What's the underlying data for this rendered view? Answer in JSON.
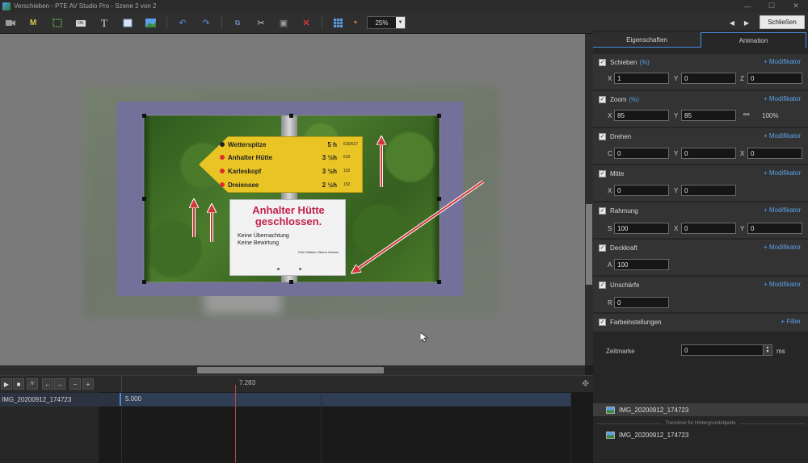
{
  "window": {
    "title": "Verschieben - PTE AV Studio Pro - Szene 2 von 2",
    "controls": [
      "—",
      "☐",
      "✕"
    ]
  },
  "toolbar": {
    "zoom_value": "25%",
    "close_label": "Schließen",
    "text_tool_label": "T",
    "mask_tool_label": "M",
    "ok_tool_label": "OK"
  },
  "canvas": {
    "sign_rows": [
      {
        "name": "Wetterspitze",
        "time": "5 h",
        "code": "616/617",
        "dot": "#222222"
      },
      {
        "name": "Anhalter Hütte",
        "time": "3 ½h",
        "code": "616",
        "dot": "#d83030"
      },
      {
        "name": "Karleskopf",
        "time": "3 ½h",
        "code": "152",
        "dot": "#d83030"
      },
      {
        "name": "Dreiensee",
        "time": "2 ½h",
        "code": "152",
        "dot": "#d83030"
      }
    ],
    "plate_title_1": "Anhalter Hütte",
    "plate_title_2": "geschlossen.",
    "plate_text_1": "Keine Übernachtung",
    "plate_text_2": "Keine Bewirtung",
    "plate_footer": "DAV Sektion Oberer Neckar"
  },
  "timeline": {
    "current_time": "7.283",
    "track_label": "IMG_20200912_174723",
    "clip_value": "5.000",
    "buttons": [
      "▶",
      "■",
      "⁄\\⁄",
      "←",
      "→",
      "−",
      "+"
    ]
  },
  "panel": {
    "tabs": [
      "Eigenschaften",
      "Animation"
    ],
    "modifier_label": "+ Modifikator",
    "filter_label": "+ Filter",
    "pct_label": "(%)",
    "sections": {
      "schieben": {
        "title": "Schieben",
        "x": "1",
        "y": "0",
        "z": "0"
      },
      "zoom": {
        "title": "Zoom",
        "x": "85",
        "y": "85",
        "percent": "100%"
      },
      "drehen": {
        "title": "Drehen",
        "c": "0",
        "y": "0",
        "x": "0"
      },
      "mitte": {
        "title": "Mitte",
        "x": "0",
        "y": "0"
      },
      "rahmung": {
        "title": "Rahmung",
        "s": "100",
        "x": "0",
        "y": "0"
      },
      "deckkraft": {
        "title": "Deckkraft",
        "a": "100"
      },
      "unschaerfe": {
        "title": "Unschärfe",
        "r": "0"
      },
      "farbeinstellungen": {
        "title": "Farbeinstellungen"
      }
    },
    "axis_labels": {
      "x": "X",
      "y": "Y",
      "z": "Z",
      "c": "C",
      "s": "S",
      "a": "A",
      "r": "R"
    },
    "zeitmarke": {
      "label": "Zeitmarke",
      "value": "0",
      "unit": "ms"
    }
  },
  "objects": {
    "items": [
      "IMG_20200912_174723",
      "IMG_20200912_174723"
    ],
    "separator": "Trennlinie für Hintergrundobjekte"
  },
  "colors": {
    "accent": "#4a8fe0",
    "frame": "#73719a",
    "arrow": "#d03838"
  }
}
